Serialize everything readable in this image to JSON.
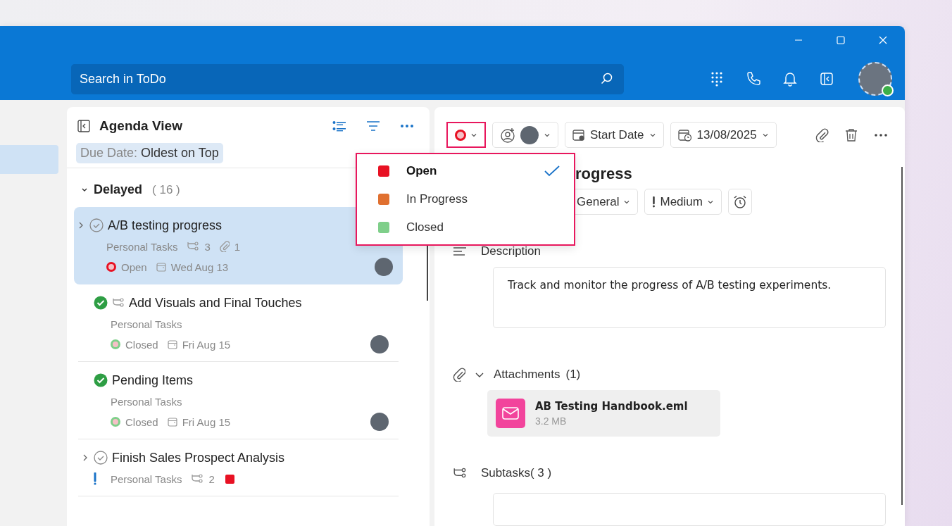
{
  "search": {
    "placeholder": "Search in ToDo"
  },
  "sidebar": {
    "items": [
      {
        "selected": true
      }
    ]
  },
  "agenda": {
    "title": "Agenda View",
    "sort": {
      "label": "Due Date:",
      "value": "Oldest on Top"
    },
    "group": {
      "name": "Delayed",
      "count": "( 16 )",
      "expanded": true
    },
    "tasks": [
      {
        "title": "A/B testing progress",
        "completed": false,
        "selected": true,
        "expandable": true,
        "subtask_icon": false,
        "priority_high": false,
        "list": "Personal Tasks",
        "subtasks": "3",
        "attachments": "1",
        "status": {
          "label": "Open",
          "color": "#e81123"
        },
        "due": "Wed Aug 13"
      },
      {
        "title": "Add Visuals and Final Touches",
        "completed": true,
        "selected": false,
        "expandable": false,
        "subtask_icon": true,
        "priority_high": false,
        "list": "Personal Tasks",
        "status": {
          "label": "Closed",
          "color": "#7fcf8a"
        },
        "due": "Fri Aug 15"
      },
      {
        "title": "Pending Items",
        "completed": true,
        "selected": false,
        "expandable": false,
        "subtask_icon": false,
        "priority_high": false,
        "list": "Personal Tasks",
        "status": {
          "label": "Closed",
          "color": "#7fcf8a"
        },
        "due": "Fri Aug 15"
      },
      {
        "title": "Finish Sales Prospect Analysis",
        "completed": false,
        "selected": false,
        "expandable": true,
        "subtask_icon": false,
        "priority_high": true,
        "list": "Personal Tasks",
        "subtasks": "2",
        "flag": {
          "color": "#e81123"
        }
      }
    ]
  },
  "detail": {
    "status": {
      "color": "#e81123"
    },
    "start_date": "Start Date",
    "due_date": "13/08/2025",
    "status_options": [
      {
        "label": "Open",
        "color": "#e81123",
        "selected": true
      },
      {
        "label": "In Progress",
        "color": "#e07030",
        "selected": false
      },
      {
        "label": "Closed",
        "color": "#7fcf8a",
        "selected": false
      }
    ],
    "title": "rogress",
    "chips": [
      {
        "kind": "category",
        "label": "General"
      },
      {
        "kind": "priority",
        "label": "Medium"
      }
    ],
    "description_label": "Description",
    "description": "Track and monitor the progress of A/B testing experiments.",
    "attachments": {
      "label": "Attachments",
      "count": "(1)",
      "expanded": true,
      "files": [
        {
          "name": "AB Testing Handbook.eml",
          "size": "3.2 MB"
        }
      ]
    },
    "subtasks_label": "Subtasks( 3 )"
  }
}
